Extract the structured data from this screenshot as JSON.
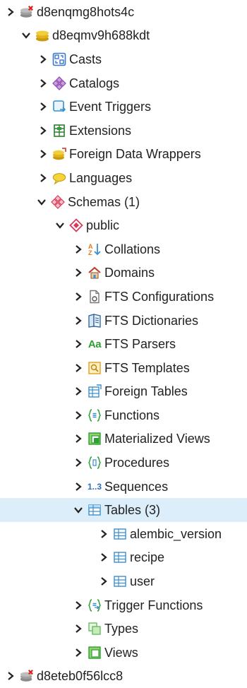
{
  "tree": {
    "server_top": {
      "label": "d8enqmg8hots4c"
    },
    "database": {
      "label": "d8eqmv9h688kdt"
    },
    "db_children": {
      "casts": "Casts",
      "catalogs": "Catalogs",
      "event_triggers": "Event Triggers",
      "extensions": "Extensions",
      "foreign_data_wrappers": "Foreign Data Wrappers",
      "languages": "Languages",
      "schemas": "Schemas (1)"
    },
    "schema": {
      "label": "public"
    },
    "schema_children": {
      "collations": "Collations",
      "domains": "Domains",
      "fts_configurations": "FTS Configurations",
      "fts_dictionaries": "FTS Dictionaries",
      "fts_parsers": "FTS Parsers",
      "fts_templates": "FTS Templates",
      "foreign_tables": "Foreign Tables",
      "functions": "Functions",
      "materialized_views": "Materialized Views",
      "procedures": "Procedures",
      "sequences": "Sequences",
      "tables": "Tables (3)",
      "trigger_functions": "Trigger Functions",
      "types": "Types",
      "views": "Views"
    },
    "tables": {
      "alembic_version": "alembic_version",
      "recipe": "recipe",
      "user": "user"
    },
    "server_bottom": {
      "label": "d8eteb0f56lcc8"
    }
  },
  "icons": {
    "aa_text": "Aa",
    "seq_text": "1..3"
  },
  "colors": {
    "selected_row": "#dbeef9",
    "db_yellow": "#e8c020",
    "server_gray": "#7a7a7a",
    "server_error": "#e02020",
    "catalog_purple": "#9b59b6",
    "schema_red": "#d63a5a",
    "table_blue": "#3a8fd0",
    "green": "#2e9e35"
  }
}
